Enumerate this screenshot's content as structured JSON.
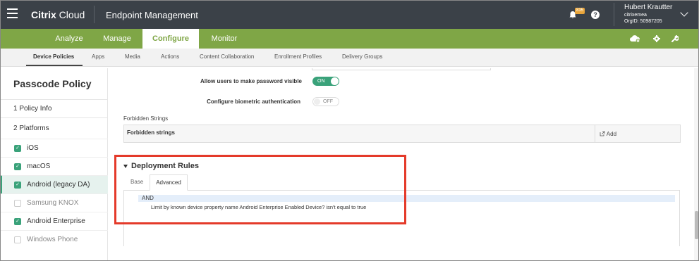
{
  "header": {
    "brand_bold": "Citrix",
    "brand_rest": " Cloud",
    "product": "Endpoint Management",
    "notification_count": "835",
    "help_glyph": "?",
    "user_name": "Hubert Krautter",
    "user_org": "citrixemea",
    "user_orgid": "OrgID: 50987205"
  },
  "main_nav": {
    "tabs": [
      "Analyze",
      "Manage",
      "Configure",
      "Monitor"
    ],
    "active": "Configure"
  },
  "sub_nav": {
    "tabs": [
      "Device Policies",
      "Apps",
      "Media",
      "Actions",
      "Content Collaboration",
      "Enrollment Profiles",
      "Delivery Groups"
    ],
    "active": "Device Policies"
  },
  "sidebar": {
    "title": "Passcode Policy",
    "step1": "1  Policy Info",
    "step2": "2  Platforms",
    "platforms": [
      {
        "label": "iOS",
        "checked": true
      },
      {
        "label": "macOS",
        "checked": true
      },
      {
        "label": "Android (legacy DA)",
        "checked": true,
        "selected": true
      },
      {
        "label": "Samsung KNOX",
        "checked": false
      },
      {
        "label": "Android Enterprise",
        "checked": true
      },
      {
        "label": "Windows Phone",
        "checked": false
      }
    ]
  },
  "settings": {
    "password_visible_label": "Allow users to make password visible",
    "password_visible_state": "ON",
    "biometric_label": "Configure biometric authentication",
    "biometric_state": "OFF"
  },
  "forbidden": {
    "section_label": "Forbidden Strings",
    "column_header": "Forbidden strings",
    "add_label": "Add"
  },
  "deployment_rules": {
    "title": "Deployment Rules",
    "tabs": [
      "Base",
      "Advanced"
    ],
    "active_tab": "Advanced",
    "operator": "AND",
    "rule": "Limit by known device property name Android Enterprise Enabled Device? isn't equal to true"
  },
  "colors": {
    "topbar": "#3b4148",
    "nav_green": "#7fa646",
    "accent_green": "#3aa27a",
    "highlight_red": "#e43a2a"
  }
}
